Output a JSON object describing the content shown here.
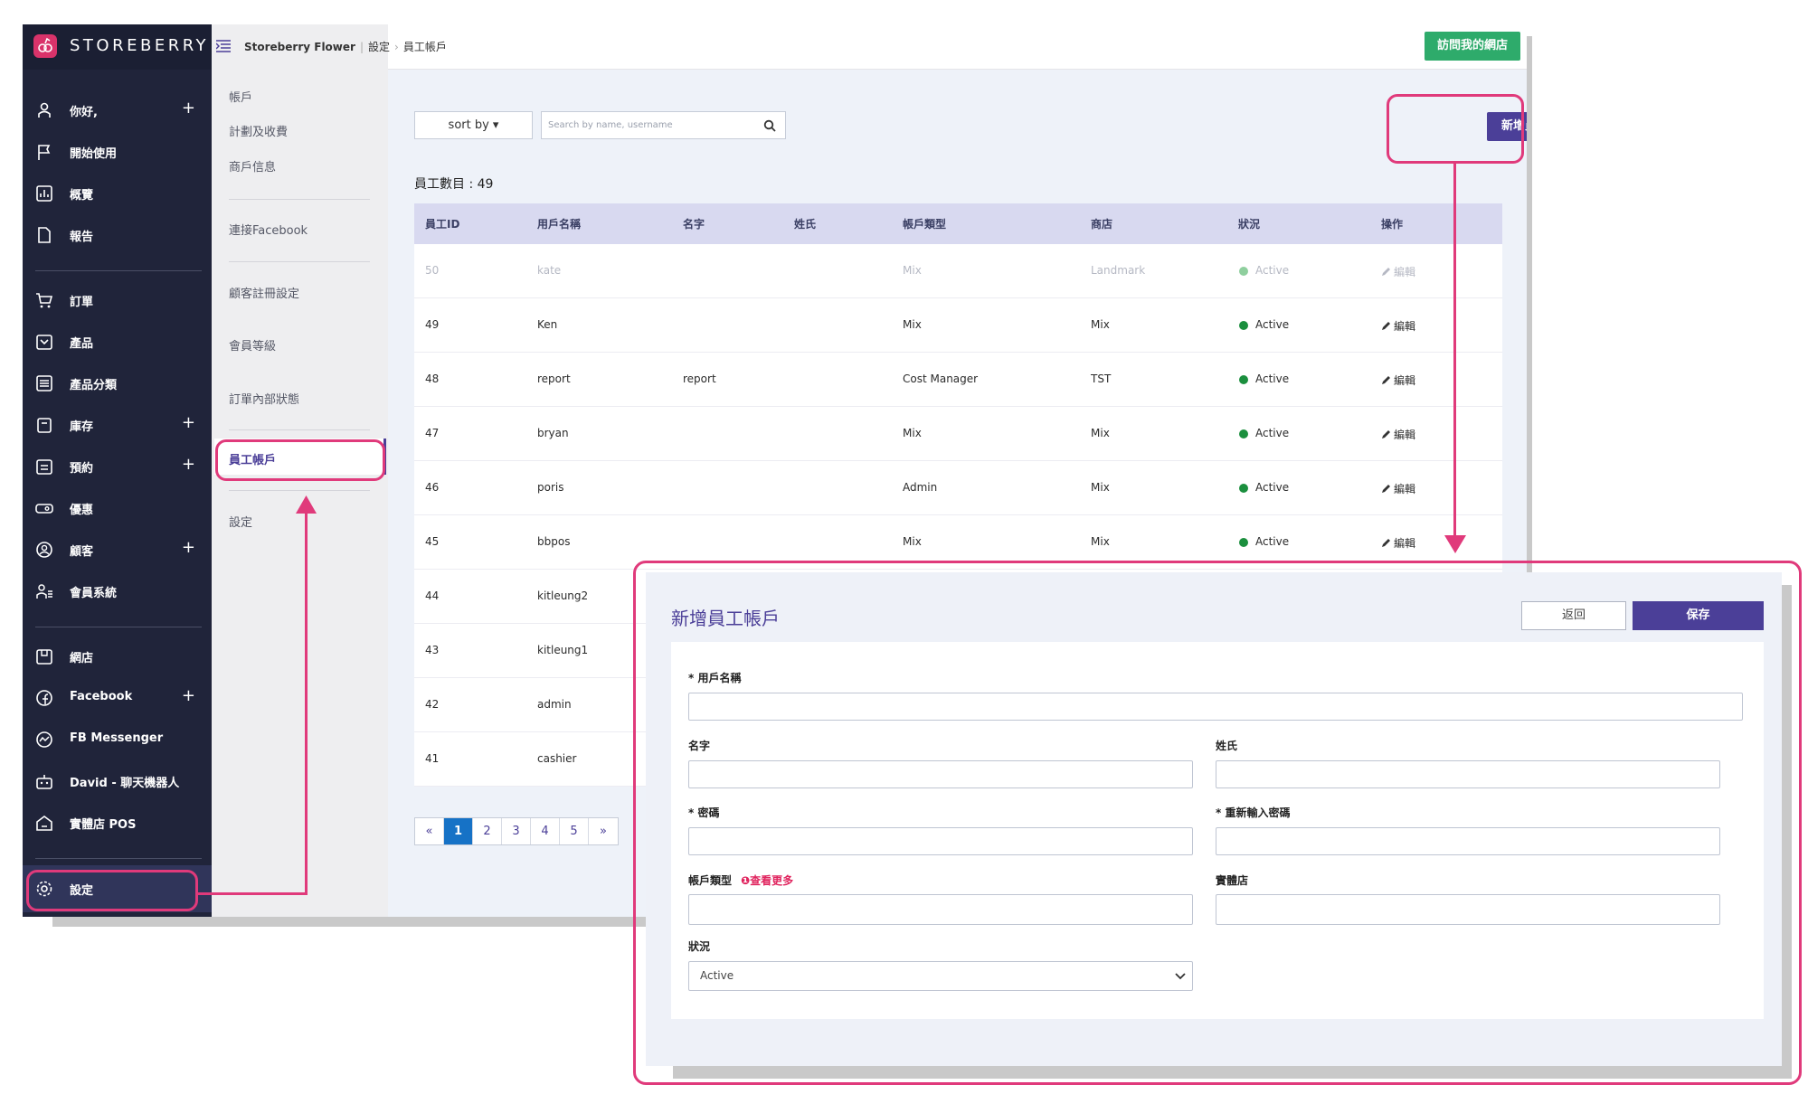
{
  "brand": "STOREBERRY",
  "nav": {
    "items": [
      {
        "label": "你好,",
        "plus": "+"
      },
      {
        "label": "開始使用",
        "plus": ""
      },
      {
        "label": "概覽",
        "plus": ""
      },
      {
        "label": "報告",
        "plus": ""
      },
      {
        "label": "訂單",
        "plus": ""
      },
      {
        "label": "產品",
        "plus": ""
      },
      {
        "label": "產品分類",
        "plus": ""
      },
      {
        "label": "庫存",
        "plus": "+"
      },
      {
        "label": "預約",
        "plus": "+"
      },
      {
        "label": "優惠",
        "plus": ""
      },
      {
        "label": "顧客",
        "plus": "+"
      },
      {
        "label": "會員系統",
        "plus": ""
      },
      {
        "label": "網店",
        "plus": ""
      },
      {
        "label": "Facebook",
        "plus": "+"
      },
      {
        "label": "FB Messenger",
        "plus": ""
      },
      {
        "label": "David - 聊天機器人",
        "plus": ""
      },
      {
        "label": "實體店 POS",
        "plus": ""
      },
      {
        "label": "設定",
        "plus": ""
      }
    ]
  },
  "subnav": {
    "items": [
      "帳戶",
      "計劃及收費",
      "商戶信息",
      "連接Facebook",
      "顧客註冊設定",
      "會員等級",
      "訂單內部狀態",
      "員工帳戶",
      "設定"
    ]
  },
  "header": {
    "shop": "Storeberry Flower",
    "crumb1": "設定",
    "crumb2": "員工帳戶",
    "visit_btn": "訪問我的網店"
  },
  "toolbar": {
    "sort_label": "sort by ▾",
    "search_placeholder": "Search by name, username",
    "add_btn": "新增員工帳戶"
  },
  "count_label": "員工數目 : 49",
  "table": {
    "columns": [
      "員工ID",
      "用戶名稱",
      "名字",
      "姓氏",
      "帳戶類型",
      "商店",
      "狀況",
      "操作"
    ],
    "edit_label": "編輯",
    "rows": [
      {
        "id": "50",
        "username": "kate",
        "first": "",
        "last": "",
        "type": "Mix",
        "store": "Landmark",
        "status": "Active"
      },
      {
        "id": "49",
        "username": "Ken",
        "first": "",
        "last": "",
        "type": "Mix",
        "store": "Mix",
        "status": "Active"
      },
      {
        "id": "48",
        "username": "report",
        "first": "report",
        "last": "",
        "type": "Cost Manager",
        "store": "TST",
        "status": "Active"
      },
      {
        "id": "47",
        "username": "bryan",
        "first": "",
        "last": "",
        "type": "Mix",
        "store": "Mix",
        "status": "Active"
      },
      {
        "id": "46",
        "username": "poris",
        "first": "",
        "last": "",
        "type": "Admin",
        "store": "Mix",
        "status": "Active"
      },
      {
        "id": "45",
        "username": "bbpos",
        "first": "",
        "last": "",
        "type": "Mix",
        "store": "Mix",
        "status": "Active"
      },
      {
        "id": "44",
        "username": "kitleung2",
        "first": "",
        "last": "",
        "type": "",
        "store": "",
        "status": ""
      },
      {
        "id": "43",
        "username": "kitleung1",
        "first": "",
        "last": "",
        "type": "",
        "store": "",
        "status": ""
      },
      {
        "id": "42",
        "username": "admin",
        "first": "",
        "last": "",
        "type": "",
        "store": "",
        "status": ""
      },
      {
        "id": "41",
        "username": "cashier",
        "first": "",
        "last": "",
        "type": "",
        "store": "",
        "status": ""
      }
    ]
  },
  "pagination": [
    "«",
    "1",
    "2",
    "3",
    "4",
    "5",
    "»"
  ],
  "modal": {
    "title": "新增員工帳戶",
    "back_btn": "返回",
    "save_btn": "保存",
    "username_label": "* 用戶名稱",
    "first_label": "名字",
    "last_label": "姓氏",
    "password_label": "* 密碼",
    "password2_label": "* 重新輸入密碼",
    "type_label": "帳戶類型",
    "more_link": "❶查看更多",
    "store_label": "實體店",
    "status_label": "狀況",
    "status_value": "Active"
  },
  "colors": {
    "sidebar": "#20243a",
    "accent": "#4b3f98",
    "green": "#2eab6b",
    "annotation": "#e03a7b",
    "status_active": "#1b8f3e"
  }
}
